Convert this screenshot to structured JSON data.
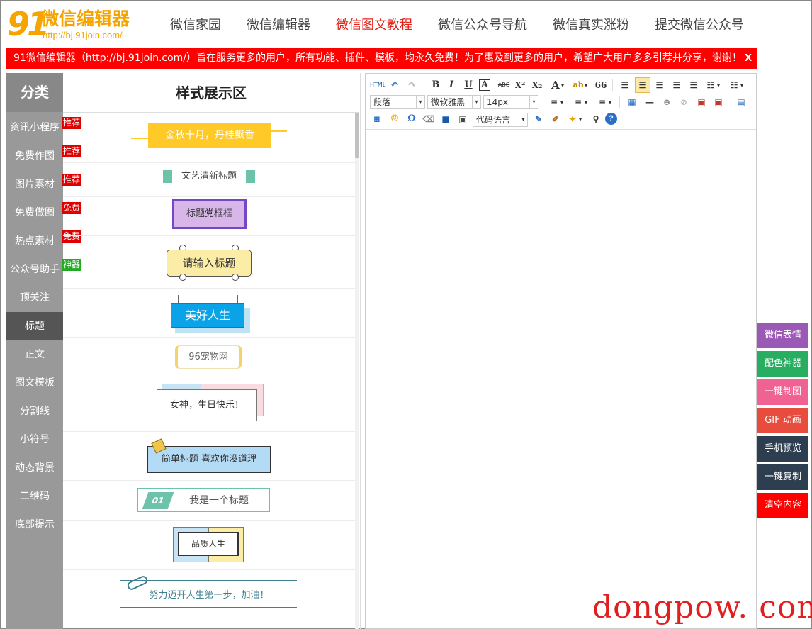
{
  "header": {
    "logo_mark": "91",
    "logo_name": "微信编辑器",
    "logo_url": "http://bj.91join.com/",
    "nav": [
      "微信家园",
      "微信编辑器",
      "微信图文教程",
      "微信公众号导航",
      "微信真实涨粉",
      "提交微信公众号"
    ],
    "active_nav": "微信图文教程",
    "brand_color": "#f5a400",
    "active_color": "#e2231a"
  },
  "notice": {
    "text": "91微信编辑器（http://bj.91join.com/）旨在服务更多的用户，所有功能、插件、模板，均永久免费！为了惠及到更多的用户，希望广大用户多多引荐并分享，谢谢！",
    "close": "X",
    "color": "#ff0000"
  },
  "sidebar": {
    "title": "分类",
    "items": [
      {
        "label": "资讯小程序",
        "badge": "推荐",
        "badge_color": "#e00000"
      },
      {
        "label": "免费作图",
        "badge": "推荐",
        "badge_color": "#e00000"
      },
      {
        "label": "图片素材",
        "badge": "推荐",
        "badge_color": "#e00000"
      },
      {
        "label": "免费做图",
        "badge": "免费",
        "badge_color": "#e00000"
      },
      {
        "label": "热点素材",
        "badge": "免费",
        "badge_color": "#e00000"
      },
      {
        "label": "公众号助手",
        "badge": "神器",
        "badge_color": "#22aa22"
      },
      {
        "label": "顶关注"
      },
      {
        "label": "标题",
        "active": true
      },
      {
        "label": "正文"
      },
      {
        "label": "图文模板"
      },
      {
        "label": "分割线"
      },
      {
        "label": "小符号"
      },
      {
        "label": "动态背景"
      },
      {
        "label": "二维码"
      },
      {
        "label": "底部提示"
      }
    ]
  },
  "panel": {
    "title": "样式展示区",
    "styles": [
      "金秋十月，丹桂飘香",
      "文艺清新标题",
      "标题党框框",
      "请输入标题",
      "美好人生",
      "96宠物网",
      "女神，生日快乐！",
      "简单标题 喜欢你没道理",
      "01",
      "我是一个标题",
      "品质人生",
      "努力迈开人生第一步，加油！"
    ]
  },
  "editor": {
    "paragraph": "段落",
    "font": "微软雅黑",
    "size": "14px",
    "code_lang": "代码语言",
    "buttons": {
      "html": "HTML",
      "bold": "B",
      "italic": "I",
      "underline": "U",
      "border": "A",
      "strike": "ABC",
      "sup": "X²",
      "sub": "X₂",
      "fontcolor": "A",
      "quote": "66",
      "omega": "Ω",
      "help": "?"
    }
  },
  "side_buttons": [
    {
      "label": "微信表情",
      "color": "#9b59b6"
    },
    {
      "label": "配色神器",
      "color": "#27ae60"
    },
    {
      "label": "一键制图",
      "color": "#f06292"
    },
    {
      "label": "GIF 动画",
      "color": "#e74c3c"
    },
    {
      "label": "手机预览",
      "color": "#2c3e50"
    },
    {
      "label": "一键复制",
      "color": "#2c3e50"
    },
    {
      "label": "清空内容",
      "color": "#ff0000"
    }
  ],
  "watermark": "dongpow. com"
}
